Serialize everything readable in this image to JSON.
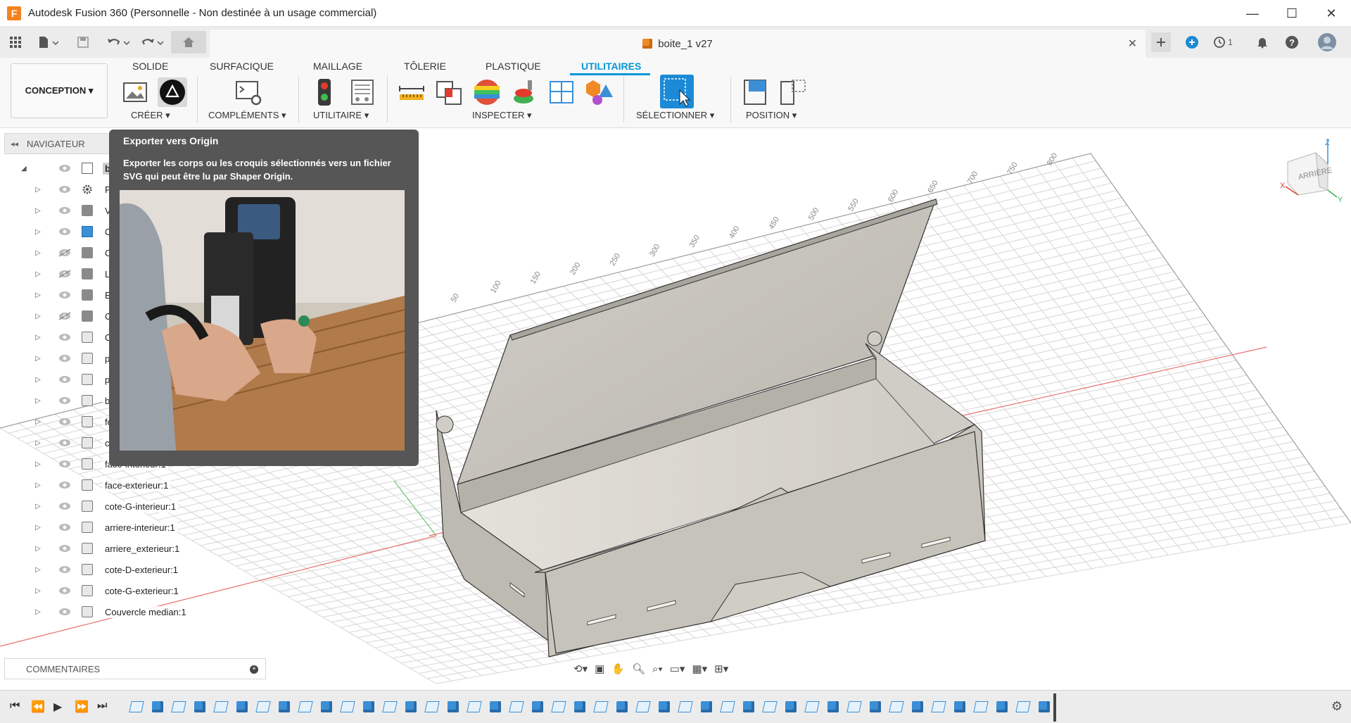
{
  "window": {
    "title": "Autodesk Fusion 360 (Personnelle - Non destinée à un usage commercial)",
    "minimize": "—",
    "maximize": "☐",
    "close": "✕"
  },
  "document": {
    "title": "boite_1 v27",
    "close": "✕",
    "job_count": "1"
  },
  "ribbon": {
    "workspace": "CONCEPTION ▾",
    "tabs": [
      "SOLIDE",
      "SURFACIQUE",
      "MAILLAGE",
      "TÔLERIE",
      "PLASTIQUE",
      "UTILITAIRES"
    ],
    "active_tab": "UTILITAIRES",
    "groups": [
      "CRÉER ▾",
      "COMPLÉMENTS ▾",
      "UTILITAIRE ▾",
      "INSPECTER ▾",
      "SÉLECTIONNER ▾",
      "POSITION ▾"
    ]
  },
  "navigator": {
    "header": "NAVIGATEUR",
    "items": [
      {
        "label": "boite",
        "icon": "component-icon"
      },
      {
        "label": "Paramè",
        "icon": "gear-icon"
      },
      {
        "label": "Vues e",
        "icon": "folder-icon"
      },
      {
        "label": "Contac",
        "icon": "contact-icon"
      },
      {
        "label": "C",
        "icon": "folder-icon"
      },
      {
        "label": "L",
        "icon": "folder-icon"
      },
      {
        "label": "E",
        "icon": "folder-icon"
      },
      {
        "label": "C",
        "icon": "folder-icon"
      },
      {
        "label": "C",
        "icon": "body-icon"
      },
      {
        "label": "p",
        "icon": "body-icon"
      },
      {
        "label": "p",
        "icon": "body-icon"
      },
      {
        "label": "b",
        "icon": "body-icon"
      },
      {
        "label": "fo",
        "icon": "body-icon"
      },
      {
        "label": "co",
        "icon": "body-icon"
      },
      {
        "label": "face-interieur:1",
        "icon": "body-icon"
      },
      {
        "label": "face-exterieur:1",
        "icon": "body-icon"
      },
      {
        "label": "cote-G-interieur:1",
        "icon": "body-icon"
      },
      {
        "label": "arriere-interieur:1",
        "icon": "body-icon"
      },
      {
        "label": "arriere_exterieur:1",
        "icon": "body-icon"
      },
      {
        "label": "cote-D-exterieur:1",
        "icon": "body-icon"
      },
      {
        "label": "cote-G-exterieur:1",
        "icon": "body-icon"
      },
      {
        "label": "Couvercle median:1",
        "icon": "body-icon"
      }
    ]
  },
  "tooltip": {
    "title": "Exporter vers Origin",
    "description": "Exporter les corps ou les croquis sélectionnés vers un fichier SVG qui peut être lu par Shaper Origin."
  },
  "comments": {
    "label": "COMMENTAIRES"
  },
  "viewcube": {
    "face": "ARRIÈRE",
    "axis_x": "X",
    "axis_y": "Y",
    "axis_z": "Z"
  },
  "grid_labels": [
    "50",
    "100",
    "150",
    "200",
    "250",
    "300",
    "350",
    "400",
    "450",
    "500",
    "550",
    "600",
    "650",
    "700",
    "750",
    "800"
  ],
  "colors": {
    "accent": "#0696d7",
    "tooltip_bg": "#565656",
    "model_face": "#c9c6bd"
  }
}
